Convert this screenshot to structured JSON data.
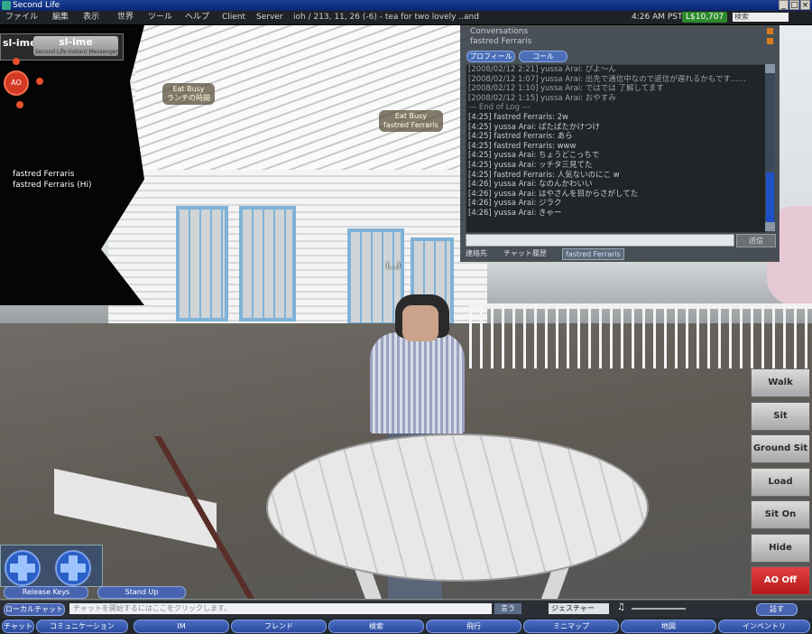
{
  "window": {
    "title": "Second Life",
    "buttons": [
      "_",
      "□",
      "×"
    ]
  },
  "menubar": {
    "items": [
      "ファイル",
      "編集",
      "表示",
      "世界",
      "ツール",
      "ヘルプ",
      "Client",
      "Server"
    ],
    "location": "ioh / 213, 11, 26 (-6) - tea for two lovely ..and",
    "time": "4:26 AM PST",
    "balance": "L$10,707",
    "search_placeholder": "検索"
  },
  "overlay": {
    "slime_label": "sl-ime",
    "slime_logo": "sl-ime",
    "slime_sub": "Second Life Instant Messenger",
    "ao_label": "AO"
  },
  "nametags": [
    {
      "text": "fastred Ferraris"
    },
    {
      "text": "fastred Ferraris (Hi)"
    },
    {
      "text": "(...)"
    }
  ],
  "signs": [
    {
      "line1": "Eat Busy",
      "line2": "ランチの時間"
    },
    {
      "line1": "Eat Busy",
      "line2": "fastred Ferraris"
    }
  ],
  "chat": {
    "header1": "Conversations",
    "header2": "fastred Ferraris",
    "btn1": "プロフィール",
    "btn2": "コール",
    "lines": [
      {
        "t": "[2008/02/12 2:21]  yussa Arai: ぴよ〜ん",
        "old": true
      },
      {
        "t": "[2008/02/12 1:07]  yussa Arai: 出先で通信中なので返信が遅れるかもです……",
        "old": true
      },
      {
        "t": "[2008/02/12 1:10]  yussa Arai: ではでは 了解してます",
        "old": true
      },
      {
        "t": "[2008/02/12 1:15]  yussa Arai: おやすみ",
        "old": true
      },
      {
        "t": "--- End of Log ---",
        "sep": true
      },
      {
        "t": "[4:25]  fastred Ferraris: 2w"
      },
      {
        "t": "[4:25]  yussa Arai: ぱたぱたかけつけ"
      },
      {
        "t": "[4:25]  fastred Ferraris: あら"
      },
      {
        "t": "[4:25]  fastred Ferraris: www"
      },
      {
        "t": "[4:25]  yussa Arai: ちょうどこっちで"
      },
      {
        "t": "[4:25]  yussa Arai: ッチタ三見てた"
      },
      {
        "t": "[4:25]  fastred Ferraris: 人気ないのにこ w"
      },
      {
        "t": "[4:26]  yussa Arai: なのんかわいい"
      },
      {
        "t": "[4:26]  yussa Arai: はやさんを目からさがしてた"
      },
      {
        "t": "[4:26]  yussa Arai: ジラク"
      },
      {
        "t": "[4:26]  yussa Arai: きゃー"
      }
    ],
    "send": "送信",
    "tabs": [
      "連絡先",
      "チャット履歴",
      "fastred Ferraris"
    ]
  },
  "ao_panel": {
    "buttons": [
      "Walk",
      "Sit",
      "Ground Sit",
      "Load",
      "Sit On",
      "Hide",
      "AO Off"
    ]
  },
  "movement": {
    "stand_button": "Stand Up",
    "fly_button": "Release Keys"
  },
  "chatbar": {
    "history_button": "ローカルチャット",
    "placeholder": "チャットを開始するにはここをクリックします。",
    "say_button": "言う",
    "gesture_select": "ジェスチャー",
    "voice_button": "話す"
  },
  "toolbar": {
    "items": [
      "チャット",
      "コミュニケーション",
      "IM",
      "フレンド",
      "検索",
      "飛行",
      "ミニマップ",
      "地図",
      "インベントリ"
    ]
  }
}
